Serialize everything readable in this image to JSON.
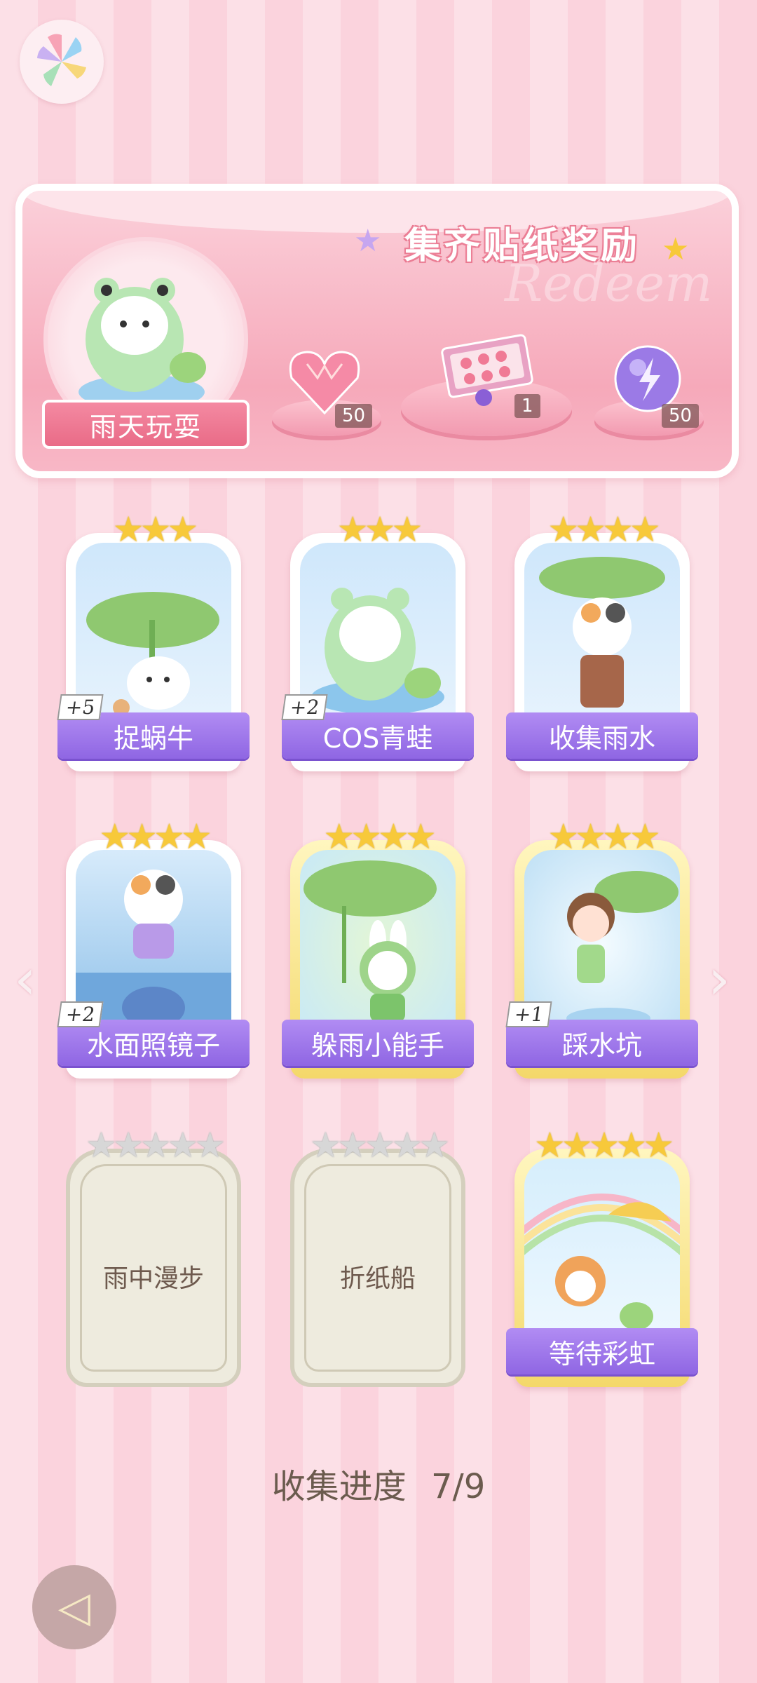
{
  "banner": {
    "title": "集齐贴纸奖励",
    "watermark": "Redeem",
    "avatar_label": "雨天玩耍",
    "rewards": [
      {
        "icon": "heart-gem-icon",
        "count": "50"
      },
      {
        "icon": "gift-box-icon",
        "count": "1"
      },
      {
        "icon": "lightning-orb-icon",
        "count": "50"
      }
    ]
  },
  "cards": [
    {
      "label": "捉蜗牛",
      "stars": "★★★",
      "bonus": "+5",
      "locked": false
    },
    {
      "label": "COS青蛙",
      "stars": "★★★",
      "bonus": "+2",
      "locked": false
    },
    {
      "label": "收集雨水",
      "stars": "★★★★",
      "bonus": "",
      "locked": false
    },
    {
      "label": "水面照镜子",
      "stars": "★★★★",
      "bonus": "+2",
      "locked": false
    },
    {
      "label": "躲雨小能手",
      "stars": "★★★★",
      "bonus": "",
      "locked": false
    },
    {
      "label": "踩水坑",
      "stars": "★★★★",
      "bonus": "+1",
      "locked": false
    },
    {
      "label": "雨中漫步",
      "stars": "★★★★★",
      "bonus": "",
      "locked": true
    },
    {
      "label": "折纸船",
      "stars": "★★★★★",
      "bonus": "",
      "locked": true
    },
    {
      "label": "等待彩虹",
      "stars": "★★★★★",
      "bonus": "",
      "locked": false
    }
  ],
  "progress": {
    "label": "收集进度",
    "value": "7/9",
    "fraction": 0.7778
  },
  "nav": {
    "left": "‹",
    "right": "›",
    "back": "◁"
  }
}
